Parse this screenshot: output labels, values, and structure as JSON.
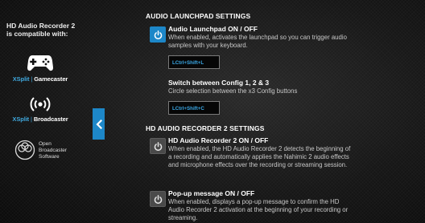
{
  "compat": {
    "title": "HD Audio Recorder 2 is compatible with:",
    "gamecaster": {
      "brand": "XSplit",
      "product": "Gamecaster",
      "icon": "gamepad-icon"
    },
    "broadcaster": {
      "brand": "XSplit",
      "product": "Broadcaster",
      "icon": "broadcast-icon"
    },
    "obs": {
      "line1": "Open",
      "line2": "Broadcaster",
      "line3": "Software",
      "icon": "obs-logo-icon"
    }
  },
  "collapse": {
    "icon": "chevron-left-icon"
  },
  "launchpad": {
    "section_title": "AUDIO LAUNCHPAD SETTINGS",
    "toggle": {
      "title": "Audio Launchpad ON / OFF",
      "desc_line1": "When enabled, activates the launchpad so you can trigger audio",
      "desc_line2": "samples with your keyboard.",
      "state": "on",
      "shortcut": "LCtrl+Shift+L"
    },
    "switch_config": {
      "title": "Switch between Config 1, 2 & 3",
      "desc": "Circle selection between the x3 Config buttons",
      "shortcut": "LCtrl+Shift+C"
    }
  },
  "recorder": {
    "section_title": "HD AUDIO RECORDER 2 SETTINGS",
    "toggle": {
      "title": "HD Audio Recorder 2 ON / OFF",
      "desc_line1": "When enabled, the HD Audio Recorder 2 detects the beginning of",
      "desc_line2": "a recording and automatically applies the Nahimic 2 audio effects",
      "desc_line3": "and microphone effects over the recording or streaming session.",
      "state": "off"
    },
    "popup": {
      "title": "Pop-up message ON / OFF",
      "desc_line1": "When enabled, displays a pop-up message to confirm the HD",
      "desc_line2": "Audio Recorder 2 activation at the beginning of your recording or",
      "desc_line3": "streaming.",
      "state": "off"
    }
  },
  "colors": {
    "accent": "#1d87c8",
    "shortcut_text": "#3aa8e6",
    "button_off": "#4a4a4a"
  }
}
